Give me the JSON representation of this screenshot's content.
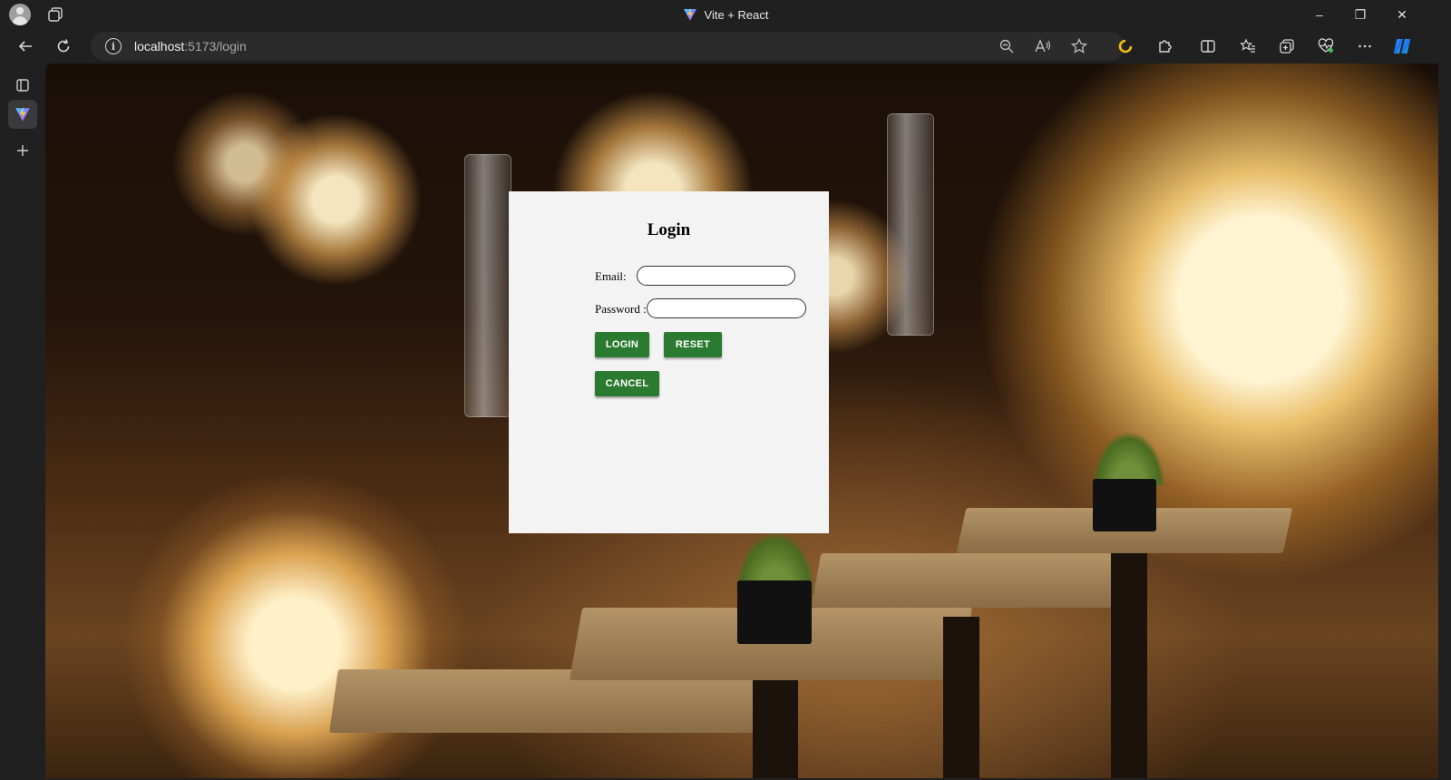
{
  "window": {
    "tab_title": "Vite + React",
    "controls": {
      "minimize": "–",
      "restore": "❐",
      "close": "✕"
    }
  },
  "toolbar": {
    "url_host": "localhost",
    "url_path": ":5173/login",
    "info_icon": "i",
    "icons": [
      "back-icon",
      "refresh-icon",
      "zoom-out-icon",
      "read-aloud-icon",
      "favorite-star-icon",
      "extension-circle-icon",
      "extensions-icon",
      "split-screen-icon",
      "favorites-icon",
      "collections-icon",
      "health-icon",
      "more-icon",
      "copilot-icon"
    ]
  },
  "side_strip": {
    "items": [
      "tab-actions-icon",
      "vite-tab-icon",
      "new-tab-icon"
    ]
  },
  "login": {
    "title": "Login",
    "email_label": "Email:",
    "password_label": "Password :",
    "email_value": "",
    "password_value": "",
    "login_button": "LOGIN",
    "reset_button": "RESET",
    "cancel_button": "CANCEL"
  },
  "colors": {
    "button_green": "#2a7a2f",
    "card_bg": "#f3f3f3",
    "chrome_bg": "#202020"
  }
}
